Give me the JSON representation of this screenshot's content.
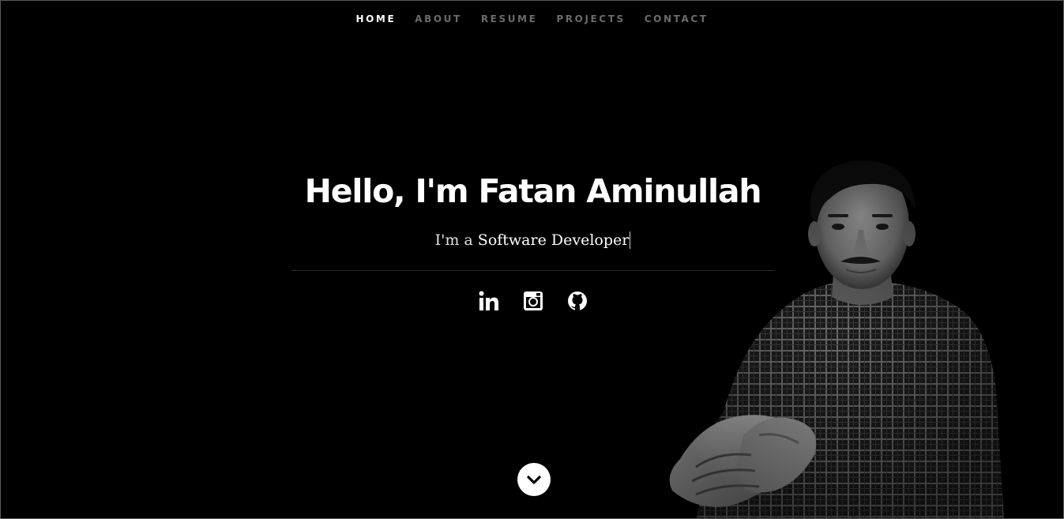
{
  "nav": {
    "items": [
      {
        "label": "HOME",
        "active": true
      },
      {
        "label": "ABOUT",
        "active": false
      },
      {
        "label": "RESUME",
        "active": false
      },
      {
        "label": "PROJECTS",
        "active": false
      },
      {
        "label": "CONTACT",
        "active": false
      }
    ]
  },
  "banner": {
    "headline": "Hello, I'm Fatan Aminullah",
    "prefix": "I'm a ",
    "role": "Software Developer"
  },
  "social": [
    {
      "icon": "linkedin-icon"
    },
    {
      "icon": "instagram-icon"
    },
    {
      "icon": "github-icon"
    }
  ],
  "scroll": {
    "icon": "chevron-down-icon"
  },
  "colors": {
    "background": "#000000",
    "nav_active": "#ffffff",
    "nav_inactive": "#6b6b6b",
    "text": "#ffffff"
  }
}
